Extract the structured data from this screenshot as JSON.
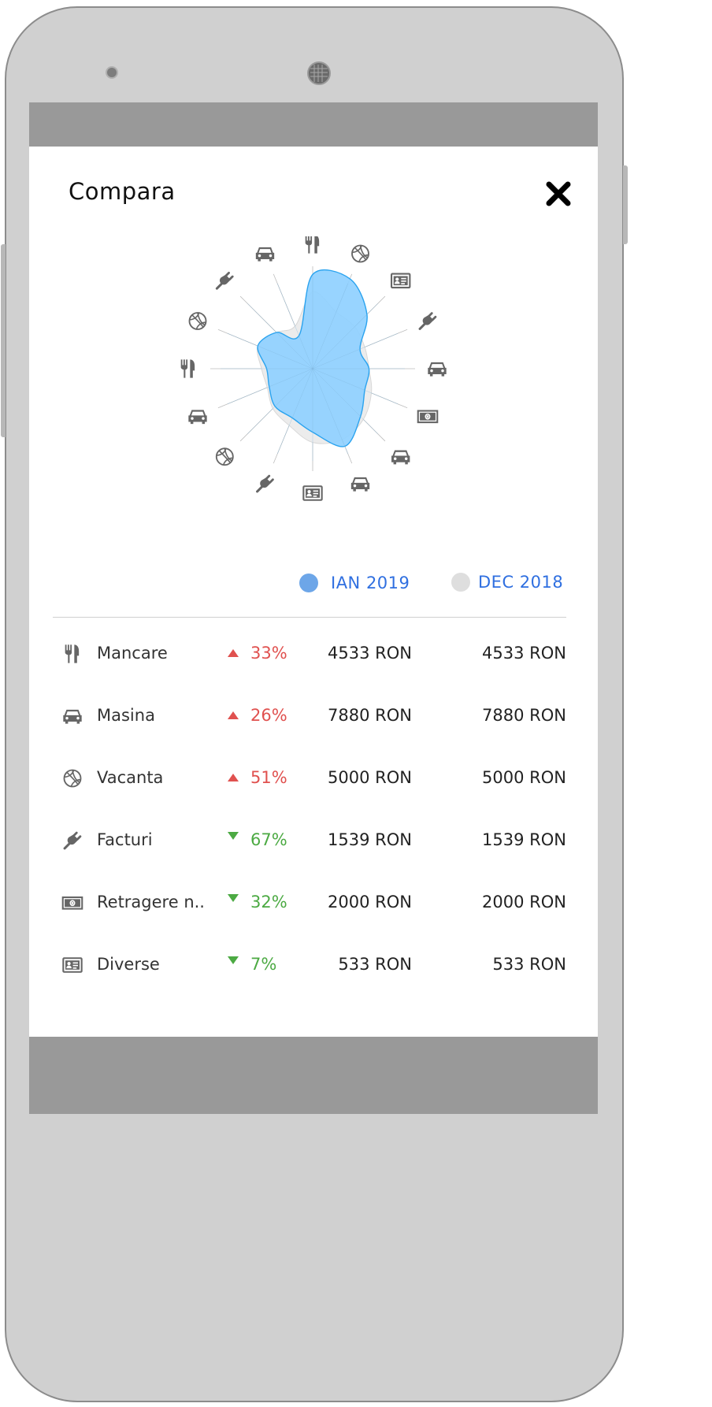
{
  "header": {
    "title": "Compara",
    "close_icon": "close-icon"
  },
  "colors": {
    "current_series": "#8fd0ff",
    "current_outline": "#2aa3ef",
    "previous_series": "#ececec",
    "legend_current_dot": "#6da6e8",
    "legend_previous_dot": "#dedede",
    "legend_text": "#2f6fe0",
    "increase": "#e0514f",
    "decrease": "#4caa43"
  },
  "legend": [
    {
      "label": "IAN 2019"
    },
    {
      "label": "DEC 2018"
    }
  ],
  "chart_data": {
    "type": "radar",
    "spokes": 16,
    "category_icons": [
      "cutlery-icon",
      "gift-icon",
      "id-card-icon",
      "plug-icon",
      "car-icon",
      "money-icon",
      "car-icon",
      "car-icon",
      "id-card-icon",
      "plug-icon",
      "gift-icon",
      "car-icon",
      "cutlery-icon",
      "gift-icon",
      "plug-icon",
      "car-icon"
    ],
    "series": [
      {
        "values": [
          0.92,
          0.95,
          0.75,
          0.5,
          0.55,
          0.55,
          0.66,
          0.82,
          0.62,
          0.52,
          0.52,
          0.46,
          0.45,
          0.58,
          0.5,
          0.35
        ]
      },
      {
        "values": [
          0.75,
          0.6,
          0.58,
          0.55,
          0.55,
          0.62,
          0.7,
          0.75,
          0.72,
          0.6,
          0.55,
          0.48,
          0.5,
          0.58,
          0.5,
          0.45
        ]
      }
    ]
  },
  "rows": [
    {
      "icon": "cutlery-icon",
      "label": "Mancare",
      "trend": "up",
      "percent": "33%",
      "current": "4533 RON",
      "previous": "4533 RON"
    },
    {
      "icon": "car-icon",
      "label": "Masina",
      "trend": "up",
      "percent": "26%",
      "current": "7880 RON",
      "previous": "7880 RON"
    },
    {
      "icon": "gift-icon",
      "label": "Vacanta",
      "trend": "up",
      "percent": "51%",
      "current": "5000 RON",
      "previous": "5000 RON"
    },
    {
      "icon": "plug-icon",
      "label": "Facturi",
      "trend": "down",
      "percent": "67%",
      "current": "1539 RON",
      "previous": "1539 RON"
    },
    {
      "icon": "money-icon",
      "label": "Retragere n..",
      "trend": "down",
      "percent": "32%",
      "current": "2000 RON",
      "previous": "2000 RON"
    },
    {
      "icon": "id-card-icon",
      "label": "Diverse",
      "trend": "down",
      "percent": "7%",
      "current": "533 RON",
      "previous": "533 RON"
    }
  ]
}
